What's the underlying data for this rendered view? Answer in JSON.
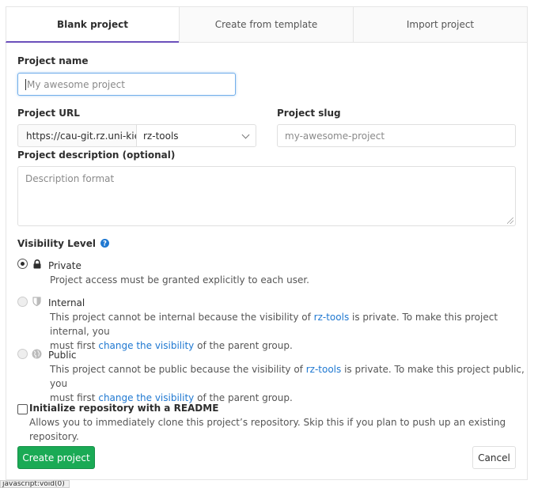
{
  "tabs": [
    {
      "label": "Blank project",
      "active": true
    },
    {
      "label": "Create from template",
      "active": false
    },
    {
      "label": "Import project",
      "active": false
    }
  ],
  "project_name": {
    "label": "Project name",
    "placeholder": "My awesome project",
    "value": ""
  },
  "project_url": {
    "label": "Project URL",
    "prefix": "https://cau-git.rz.uni-kiel.de/",
    "namespace": "rz-tools"
  },
  "project_slug": {
    "label": "Project slug",
    "placeholder": "my-awesome-project"
  },
  "description": {
    "label": "Project description (optional)",
    "placeholder": "Description format"
  },
  "visibility": {
    "label": "Visibility Level",
    "help_icon": "question-circle-icon",
    "options": [
      {
        "name": "Private",
        "icon": "lock-icon",
        "checked": true,
        "disabled": false,
        "help": "Project access must be granted explicitly to each user."
      },
      {
        "name": "Internal",
        "icon": "shield-icon",
        "checked": false,
        "disabled": true,
        "help_a": "This project cannot be internal because the visibility of ",
        "group": "rz-tools",
        "help_b": " is private. To make this project internal, you",
        "help_c": "must first ",
        "link": "change the visibility",
        "help_d": " of the parent group."
      },
      {
        "name": "Public",
        "icon": "globe-icon",
        "checked": false,
        "disabled": true,
        "help_a": "This project cannot be public because the visibility of ",
        "group": "rz-tools",
        "help_b": " is private. To make this project public, you",
        "help_c": "must first ",
        "link": "change the visibility",
        "help_d": " of the parent group."
      }
    ]
  },
  "readme": {
    "label": "Initialize repository with a README",
    "help": "Allows you to immediately clone this project’s repository. Skip this if you plan to push up an existing repository."
  },
  "buttons": {
    "create": "Create project",
    "cancel": "Cancel"
  },
  "status_bar": "javascript:void(0)",
  "colors": {
    "primary": "#1aaa55",
    "link": "#1f78d1",
    "tab_active_border": "#6b4fbb",
    "focus": "#73afea"
  }
}
